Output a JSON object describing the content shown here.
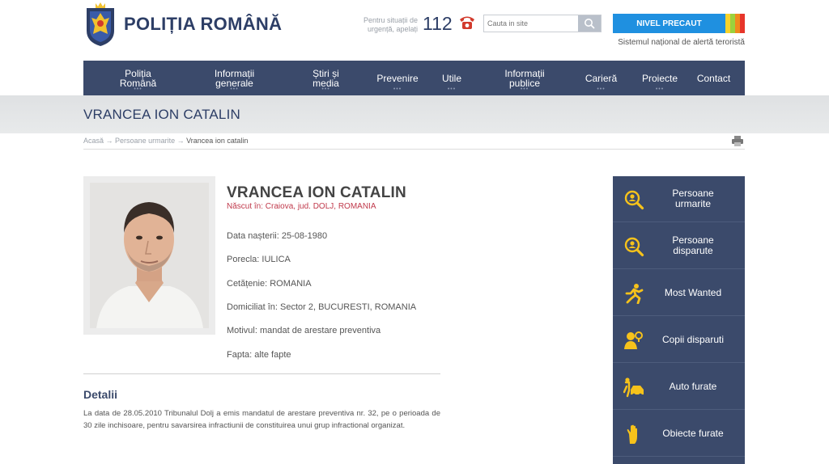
{
  "header": {
    "logo_text": "POLIȚIA ROMÂNĂ",
    "emergency_text_1": "Pentru situații de",
    "emergency_text_2": "urgență, apelați",
    "emergency_number": "112",
    "search_placeholder": "Cauta in site",
    "alert_label": "NIVEL PRECAUT",
    "alert_subtitle": "Sistemul național de alertă teroristă",
    "alert_colors": [
      "#1f90e0",
      "#f6d32b",
      "#9bd23c",
      "#f08a1c",
      "#e7352a"
    ]
  },
  "nav": [
    {
      "line1": "Poliția",
      "line2": "Română"
    },
    {
      "line1": "Informații",
      "line2": "generale"
    },
    {
      "line1": "Știri și",
      "line2": "media"
    },
    {
      "line1": "Prevenire",
      "line2": ""
    },
    {
      "line1": "Utile",
      "line2": ""
    },
    {
      "line1": "Informații",
      "line2": "publice"
    },
    {
      "line1": "Carieră",
      "line2": ""
    },
    {
      "line1": "Proiecte",
      "line2": ""
    },
    {
      "line1": "Contact",
      "line2": ""
    }
  ],
  "page_title": "VRANCEA ION CATALIN",
  "breadcrumb": {
    "home": "Acasă",
    "sep": "→",
    "section": "Persoane urmarite",
    "current": "Vrancea ion catalin"
  },
  "person": {
    "name": "VRANCEA ION CATALIN",
    "born": "Născut în: Craiova, jud. DOLJ, ROMANIA",
    "birth_date": "Data nașterii: 25-08-1980",
    "nickname": "Porecla: IULICA",
    "citizenship": "Cetățenie: ROMANIA",
    "domicile": "Domiciliat în: Sector 2, BUCURESTI, ROMANIA",
    "reason": "Motivul: mandat de arestare preventiva",
    "offense": "Fapta: alte fapte"
  },
  "details": {
    "heading": "Detalii",
    "text": "La data de 28.05.2010 Tribunalul Dolj a emis mandatul de arestare preventiva nr. 32, pe o perioada de 30 zile inchisoare, pentru savarsirea infractiunii de constituirea unui grup infractional organizat."
  },
  "side_menu": [
    {
      "line1": "Persoane",
      "line2": "urmarite",
      "icon": "magnifier-person-icon"
    },
    {
      "line1": "Persoane",
      "line2": "disparute",
      "icon": "magnifier-person-icon"
    },
    {
      "line1": "Most Wanted",
      "line2": "",
      "icon": "running-man-icon"
    },
    {
      "line1": "Copii disparuti",
      "line2": "",
      "icon": "children-icon"
    },
    {
      "line1": "Auto furate",
      "line2": "",
      "icon": "car-thief-icon"
    },
    {
      "line1": "Obiecte furate",
      "line2": "",
      "icon": "hand-icon"
    }
  ],
  "colors": {
    "nav_bg": "#3b4a6b",
    "accent_red": "#c0394b",
    "icon_yellow": "#f6c21b"
  }
}
